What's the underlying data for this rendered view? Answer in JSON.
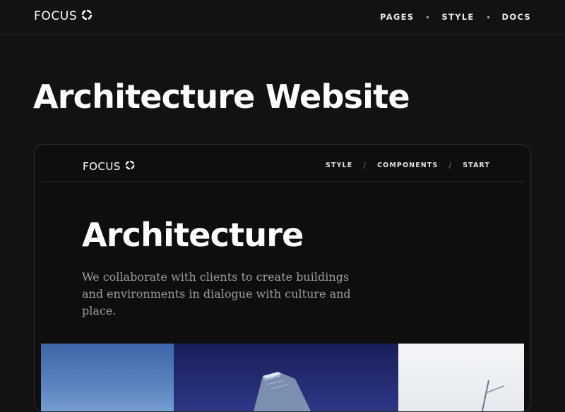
{
  "site": {
    "brand": "FOCUS",
    "nav": [
      "PAGES",
      "STYLE",
      "DOCS"
    ]
  },
  "page": {
    "title": "Architecture Website"
  },
  "preview": {
    "brand": "FOCUS",
    "nav": [
      "STYLE",
      "COMPONENTS",
      "START"
    ],
    "hero_title": "Architecture",
    "hero_text": "We collaborate with clients to create buildings and environments in dialogue with culture and place."
  },
  "colors": {
    "background": "#121212",
    "card_background": "#0e0e0e",
    "body_text": "#9c9c9c",
    "sky_blue": "#5b84c0",
    "facade_navy": "#27307a"
  },
  "icons": {
    "brand_mark": "ring-icon"
  }
}
